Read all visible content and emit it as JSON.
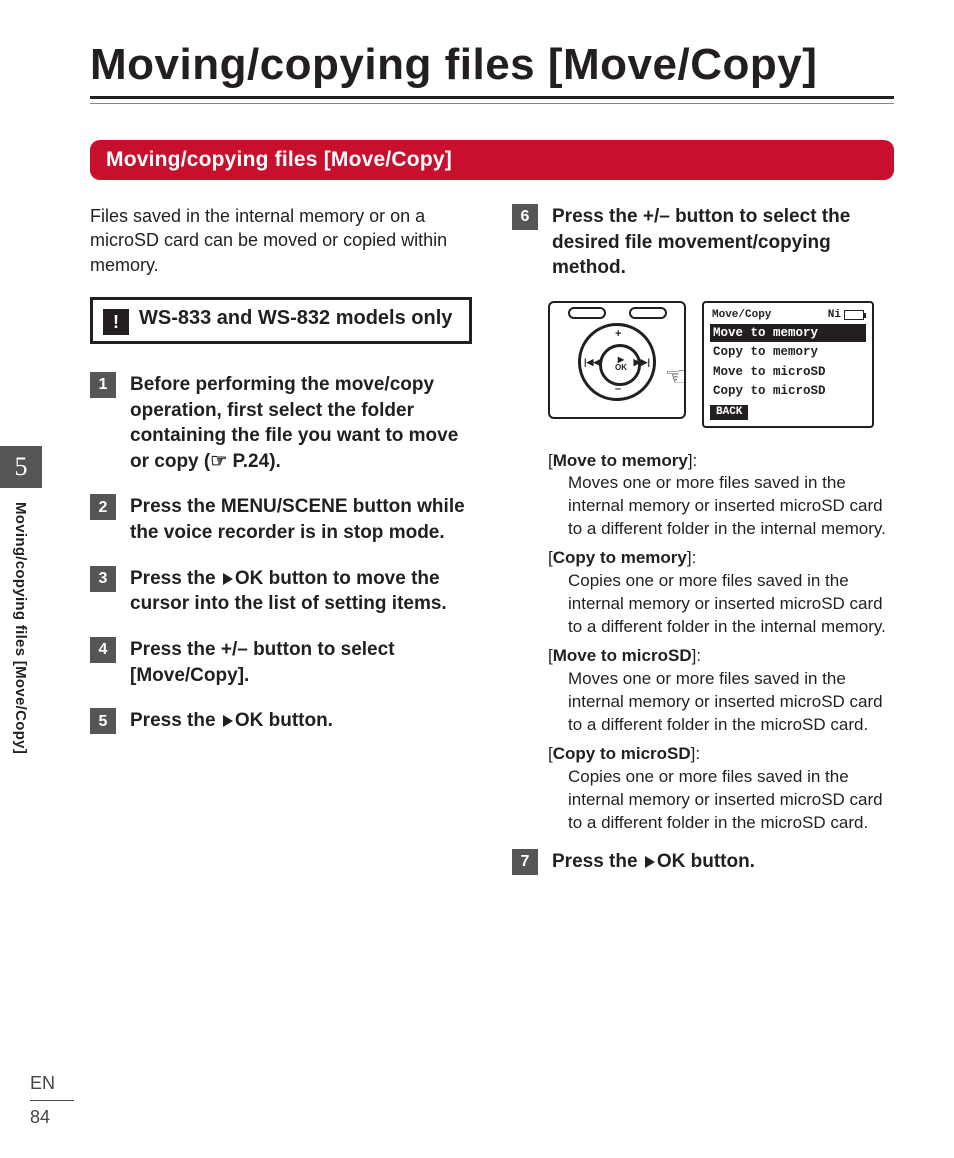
{
  "page_title": "Moving/copying files [Move/Copy]",
  "section_bar": "Moving/copying files [Move/Copy]",
  "intro": "Files saved in the internal memory or on a microSD card can be moved or copied within memory.",
  "notice": {
    "icon": "!",
    "text": "WS-833 and WS-832 models only"
  },
  "steps": {
    "s1": {
      "num": "1",
      "pre": "Before performing the move/copy operation, first select the folder containing the file you want to move or copy (",
      "ref": "☞ P.24",
      "post": ")."
    },
    "s2": {
      "num": "2",
      "pre": "Press the ",
      "btn": "MENU/SCENE",
      "post": " button while the voice recorder is in stop mode."
    },
    "s3": {
      "num": "3",
      "pre": "Press the ",
      "btn": "OK",
      "post": " button to move the cursor into the list of setting items."
    },
    "s4": {
      "num": "4",
      "pre": "Press the ",
      "btn1": "+",
      "mid": "/",
      "btn2": "–",
      "post1": " button to select [",
      "val": "Move/Copy",
      "post2": "]."
    },
    "s5": {
      "num": "5",
      "pre": "Press the ",
      "btn": "OK",
      "post": " button."
    },
    "s6": {
      "num": "6",
      "pre": "Press the ",
      "btn1": "+",
      "mid": "/",
      "btn2": "–",
      "post": " button to select the desired file movement/copying method."
    },
    "s7": {
      "num": "7",
      "pre": "Press the ",
      "btn": "OK",
      "post": " button."
    }
  },
  "lcd": {
    "title": "Move/Copy",
    "ni": "Ni",
    "options": [
      "Move to memory",
      "Copy to memory",
      "Move to microSD",
      "Copy to microSD"
    ],
    "selected_index": 0,
    "back": "BACK"
  },
  "defs": [
    {
      "term": "Move to memory",
      "desc": "Moves one or more files saved in the internal memory or inserted microSD card to a different folder in the internal memory."
    },
    {
      "term": "Copy to memory",
      "desc": "Copies one or more files saved in the internal memory or inserted microSD card to a different folder in the internal memory."
    },
    {
      "term": "Move to microSD",
      "desc": "Moves one or more files saved in the internal memory or inserted microSD card to a different folder in the microSD card."
    },
    {
      "term": "Copy to microSD",
      "desc": "Copies one or more files saved in the internal memory or inserted microSD card to a different folder in the microSD card."
    }
  ],
  "sidetab": {
    "chapter": "5",
    "label": "Moving/copying files [Move/Copy]"
  },
  "footer": {
    "lang": "EN",
    "page": "84"
  }
}
